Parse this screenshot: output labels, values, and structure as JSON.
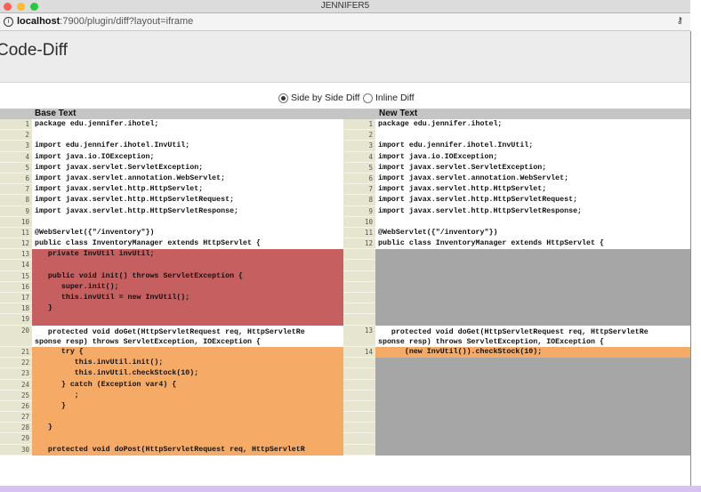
{
  "window": {
    "title": "JENNIFER5"
  },
  "browser": {
    "url_host": "localhost",
    "url_rest": ":7900/plugin/diff?layout=iframe"
  },
  "page": {
    "title": "Code-Diff"
  },
  "options": {
    "side_by_side": "Side by Side Diff",
    "inline": "Inline Diff",
    "selected": "side_by_side"
  },
  "left": {
    "header": "Base Text",
    "lines": [
      {
        "n": "1",
        "t": "package edu.jennifer.ihotel;",
        "k": "eq"
      },
      {
        "n": "2",
        "t": "",
        "k": "eq"
      },
      {
        "n": "3",
        "t": "import edu.jennifer.ihotel.InvUtil;",
        "k": "eq"
      },
      {
        "n": "4",
        "t": "import java.io.IOException;",
        "k": "eq"
      },
      {
        "n": "5",
        "t": "import javax.servlet.ServletException;",
        "k": "eq"
      },
      {
        "n": "6",
        "t": "import javax.servlet.annotation.WebServlet;",
        "k": "eq"
      },
      {
        "n": "7",
        "t": "import javax.servlet.http.HttpServlet;",
        "k": "eq"
      },
      {
        "n": "8",
        "t": "import javax.servlet.http.HttpServletRequest;",
        "k": "eq"
      },
      {
        "n": "9",
        "t": "import javax.servlet.http.HttpServletResponse;",
        "k": "eq"
      },
      {
        "n": "10",
        "t": "",
        "k": "eq"
      },
      {
        "n": "11",
        "t": "@WebServlet({\"/inventory\"})",
        "k": "eq"
      },
      {
        "n": "12",
        "t": "public class InventoryManager extends HttpServlet {",
        "k": "eq"
      },
      {
        "n": "13",
        "t": "   private InvUtil invUtil;",
        "k": "del"
      },
      {
        "n": "14",
        "t": "",
        "k": "del"
      },
      {
        "n": "15",
        "t": "   public void init() throws ServletException {",
        "k": "del"
      },
      {
        "n": "16",
        "t": "      super.init();",
        "k": "del"
      },
      {
        "n": "17",
        "t": "      this.invUtil = new InvUtil();",
        "k": "del"
      },
      {
        "n": "18",
        "t": "   }",
        "k": "del"
      },
      {
        "n": "19",
        "t": "",
        "k": "del"
      },
      {
        "n": "20",
        "t": "   protected void doGet(HttpServletRequest req, HttpServletRe\nsponse resp) throws ServletException, IOException {",
        "k": "white",
        "h": 2
      },
      {
        "n": "21",
        "t": "      try {",
        "k": "chg"
      },
      {
        "n": "22",
        "t": "         this.invUtil.init();",
        "k": "chg"
      },
      {
        "n": "23",
        "t": "         this.invUtil.checkStock(10);",
        "k": "chg"
      },
      {
        "n": "24",
        "t": "      } catch (Exception var4) {",
        "k": "chg"
      },
      {
        "n": "25",
        "t": "         ;",
        "k": "chg"
      },
      {
        "n": "26",
        "t": "      }",
        "k": "chg"
      },
      {
        "n": "27",
        "t": "",
        "k": "chg"
      },
      {
        "n": "28",
        "t": "   }",
        "k": "chg"
      },
      {
        "n": "29",
        "t": "",
        "k": "chg"
      },
      {
        "n": "30",
        "t": "   protected void doPost(HttpServletRequest req, HttpServletR",
        "k": "chg"
      }
    ]
  },
  "right": {
    "header": "New Text",
    "lines": [
      {
        "n": "1",
        "t": "package edu.jennifer.ihotel;",
        "k": "eq"
      },
      {
        "n": "2",
        "t": "",
        "k": "eq"
      },
      {
        "n": "3",
        "t": "import edu.jennifer.ihotel.InvUtil;",
        "k": "eq"
      },
      {
        "n": "4",
        "t": "import java.io.IOException;",
        "k": "eq"
      },
      {
        "n": "5",
        "t": "import javax.servlet.ServletException;",
        "k": "eq"
      },
      {
        "n": "6",
        "t": "import javax.servlet.annotation.WebServlet;",
        "k": "eq"
      },
      {
        "n": "7",
        "t": "import javax.servlet.http.HttpServlet;",
        "k": "eq"
      },
      {
        "n": "8",
        "t": "import javax.servlet.http.HttpServletRequest;",
        "k": "eq"
      },
      {
        "n": "9",
        "t": "import javax.servlet.http.HttpServletResponse;",
        "k": "eq"
      },
      {
        "n": "10",
        "t": "",
        "k": "eq"
      },
      {
        "n": "11",
        "t": "@WebServlet({\"/inventory\"})",
        "k": "eq"
      },
      {
        "n": "12",
        "t": "public class InventoryManager extends HttpServlet {",
        "k": "eq"
      },
      {
        "n": "",
        "t": "",
        "k": "empty"
      },
      {
        "n": "",
        "t": "",
        "k": "empty"
      },
      {
        "n": "",
        "t": "",
        "k": "empty"
      },
      {
        "n": "",
        "t": "",
        "k": "empty"
      },
      {
        "n": "",
        "t": "",
        "k": "empty"
      },
      {
        "n": "",
        "t": "",
        "k": "empty"
      },
      {
        "n": "",
        "t": "",
        "k": "empty"
      },
      {
        "n": "13",
        "t": "   protected void doGet(HttpServletRequest req, HttpServletRe\nsponse resp) throws ServletException, IOException {",
        "k": "white",
        "h": 2
      },
      {
        "n": "14",
        "t": "      (new InvUtil()).checkStock(10);",
        "k": "chg"
      },
      {
        "n": "",
        "t": "",
        "k": "empty"
      },
      {
        "n": "",
        "t": "",
        "k": "empty"
      },
      {
        "n": "",
        "t": "",
        "k": "empty"
      },
      {
        "n": "",
        "t": "",
        "k": "empty"
      },
      {
        "n": "",
        "t": "",
        "k": "empty"
      },
      {
        "n": "",
        "t": "",
        "k": "empty"
      },
      {
        "n": "",
        "t": "",
        "k": "empty"
      },
      {
        "n": "",
        "t": "",
        "k": "empty"
      },
      {
        "n": "",
        "t": "",
        "k": "empty"
      }
    ]
  },
  "colors": {
    "deleted": "#c55f60",
    "changed": "#f5ab66",
    "empty": "#a6a6a6",
    "gutter": "#e6e6d0"
  }
}
